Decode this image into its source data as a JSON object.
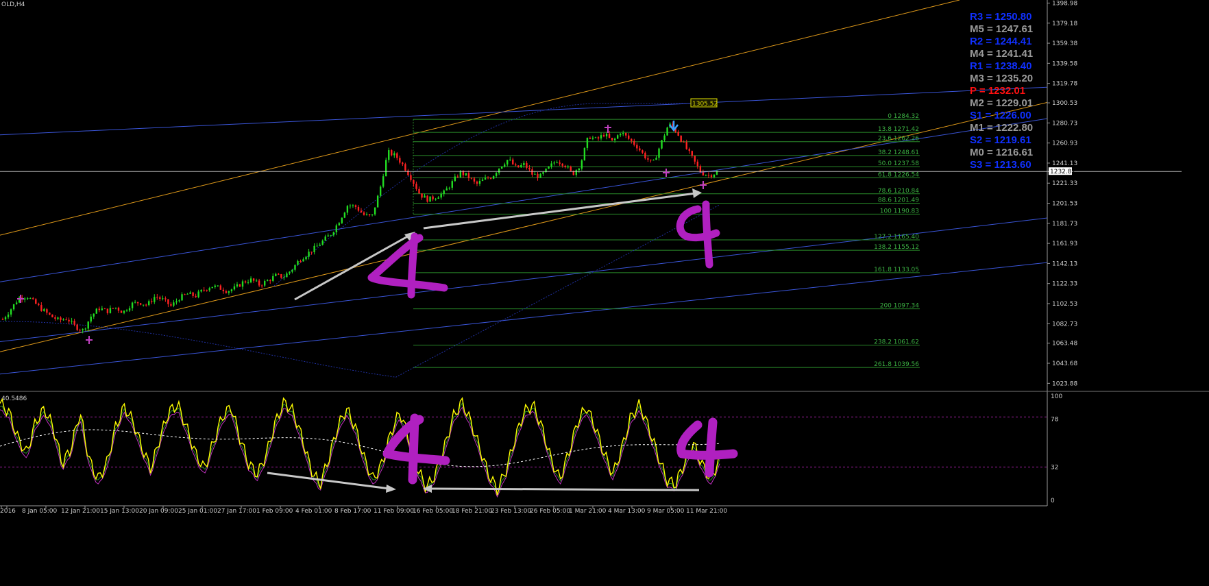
{
  "header": {
    "symbol": "OLD,H4",
    "osc_label": "40.5486"
  },
  "colors": {
    "background": "#000000",
    "bull": "#22dd22",
    "bear": "#ff2222",
    "fib": "#2a8c2a",
    "fib_text": "#3cb043",
    "channel_blue": "#3a55d8",
    "channel_orange": "#e09a1a",
    "stoch": "#ffff00",
    "annot": "#b020c0",
    "arrow": "#c8c8c8",
    "pivot_blue": "#1030ff",
    "pivot_gray": "#9a9a9a",
    "pivot_red": "#ff1010"
  },
  "chart_data": [
    {
      "type": "candlestick",
      "timeframe": "H4",
      "ylim": [
        1018,
        1402
      ],
      "price_ticks": [
        1398.98,
        1379.18,
        1359.38,
        1339.58,
        1319.78,
        1300.53,
        1280.73,
        1260.93,
        1241.13,
        1221.33,
        1201.53,
        1181.73,
        1161.93,
        1142.13,
        1122.33,
        1102.53,
        1082.73,
        1063.48,
        1043.68,
        1023.88
      ],
      "current_price": "1232.87",
      "x_ticks": [
        "2016",
        "8 Jan 05:00",
        "12 Jan 21:00",
        "15 Jan 13:00",
        "20 Jan 09:00",
        "25 Jan 01:00",
        "27 Jan 17:00",
        "1 Feb 09:00",
        "4 Feb 01:00",
        "8 Feb 17:00",
        "11 Feb 09:00",
        "16 Feb 05:00",
        "18 Feb 21:00",
        "23 Feb 13:00",
        "26 Feb 05:00",
        "1 Mar 21:00",
        "4 Mar 13:00",
        "9 Mar 05:00",
        "11 Mar 21:00"
      ],
      "close_path": [
        1087,
        1097,
        1108,
        1110,
        1103,
        1096,
        1090,
        1086,
        1088,
        1080,
        1076,
        1090,
        1098,
        1095,
        1099,
        1094,
        1102,
        1104,
        1101,
        1110,
        1106,
        1100,
        1108,
        1112,
        1110,
        1116,
        1120,
        1118,
        1115,
        1118,
        1124,
        1126,
        1121,
        1125,
        1130,
        1129,
        1136,
        1146,
        1152,
        1158,
        1165,
        1172,
        1185,
        1200,
        1198,
        1190,
        1188,
        1215,
        1252,
        1248,
        1238,
        1225,
        1210,
        1205,
        1208,
        1212,
        1222,
        1232,
        1228,
        1220,
        1225,
        1228,
        1238,
        1245,
        1236,
        1240,
        1230,
        1228,
        1236,
        1244,
        1240,
        1230,
        1240,
        1268,
        1264,
        1270,
        1262,
        1272,
        1265,
        1258,
        1248,
        1240,
        1260,
        1280,
        1272,
        1258,
        1245,
        1232,
        1229,
        1232
      ],
      "fib_levels": [
        {
          "pct": "0",
          "price": 1284.32,
          "label": "0 1284.32"
        },
        {
          "pct": "13.8",
          "price": 1271.42,
          "label": "13.8 1271.42"
        },
        {
          "pct": "23.6",
          "price": 1262.26,
          "label": "23.6 1262.26"
        },
        {
          "pct": "38.2",
          "price": 1248.61,
          "label": "38.2 1248.61"
        },
        {
          "pct": "50.0",
          "price": 1237.58,
          "label": "50.0 1237.58"
        },
        {
          "pct": "61.8",
          "price": 1226.54,
          "label": "61.8 1226.54"
        },
        {
          "pct": "78.6",
          "price": 1210.84,
          "label": "78.6 1210.84"
        },
        {
          "pct": "88.6",
          "price": 1201.49,
          "label": "88.6 1201.49"
        },
        {
          "pct": "100",
          "price": 1190.83,
          "label": "100 1190.83"
        },
        {
          "pct": "127.2",
          "price": 1165.4,
          "label": "127.2 1165.40"
        },
        {
          "pct": "138.2",
          "price": 1155.12,
          "label": "138.2 1155.12"
        },
        {
          "pct": "161.8",
          "price": 1133.05,
          "label": "161.8 1133.05"
        },
        {
          "pct": "200",
          "price": 1097.34,
          "label": "200 1097.34"
        },
        {
          "pct": "238.2",
          "price": 1061.62,
          "label": "238.2 1061.62"
        },
        {
          "pct": "261.8",
          "price": 1039.56,
          "label": "261.8 1039.56"
        }
      ],
      "price_label": "1305.52",
      "pivots": [
        {
          "label": "R3 = 1250.80",
          "kind": "blue"
        },
        {
          "label": "M5 = 1247.61",
          "kind": "gray"
        },
        {
          "label": "R2 = 1244.41",
          "kind": "blue"
        },
        {
          "label": "M4 = 1241.41",
          "kind": "gray"
        },
        {
          "label": "R1 = 1238.40",
          "kind": "blue"
        },
        {
          "label": "M3 = 1235.20",
          "kind": "gray"
        },
        {
          "label": "P   = 1232.01",
          "kind": "red"
        },
        {
          "label": "M2 = 1229.01",
          "kind": "gray"
        },
        {
          "label": "S1 = 1226.00",
          "kind": "blue"
        },
        {
          "label": "M1 = 1222.80",
          "kind": "gray"
        },
        {
          "label": "S2 = 1219.61",
          "kind": "blue"
        },
        {
          "label": "M0 = 1216.61",
          "kind": "gray"
        },
        {
          "label": "S3 = 1213.60",
          "kind": "blue"
        }
      ],
      "annotations": [
        "4",
        "4"
      ]
    },
    {
      "type": "line",
      "name": "stochastic oscillator",
      "ylim": [
        0,
        100
      ],
      "ticks": [
        100,
        78,
        32,
        0
      ],
      "levels": [
        80,
        32
      ],
      "k_values": [
        93,
        85,
        60,
        45,
        75,
        88,
        70,
        35,
        50,
        85,
        40,
        20,
        35,
        70,
        90,
        75,
        50,
        30,
        60,
        85,
        92,
        70,
        45,
        30,
        55,
        80,
        90,
        60,
        35,
        25,
        45,
        75,
        95,
        85,
        60,
        30,
        15,
        40,
        70,
        88,
        70,
        40,
        20,
        35,
        65,
        85,
        60,
        30,
        12,
        25,
        50,
        80,
        95,
        75,
        50,
        25,
        10,
        30,
        60,
        85,
        92,
        70,
        40,
        20,
        45,
        75,
        90,
        70,
        45,
        25,
        50,
        80,
        92,
        70,
        45,
        20,
        15,
        35,
        55,
        35,
        20,
        40
      ],
      "annotations": [
        "4",
        "4"
      ]
    }
  ]
}
